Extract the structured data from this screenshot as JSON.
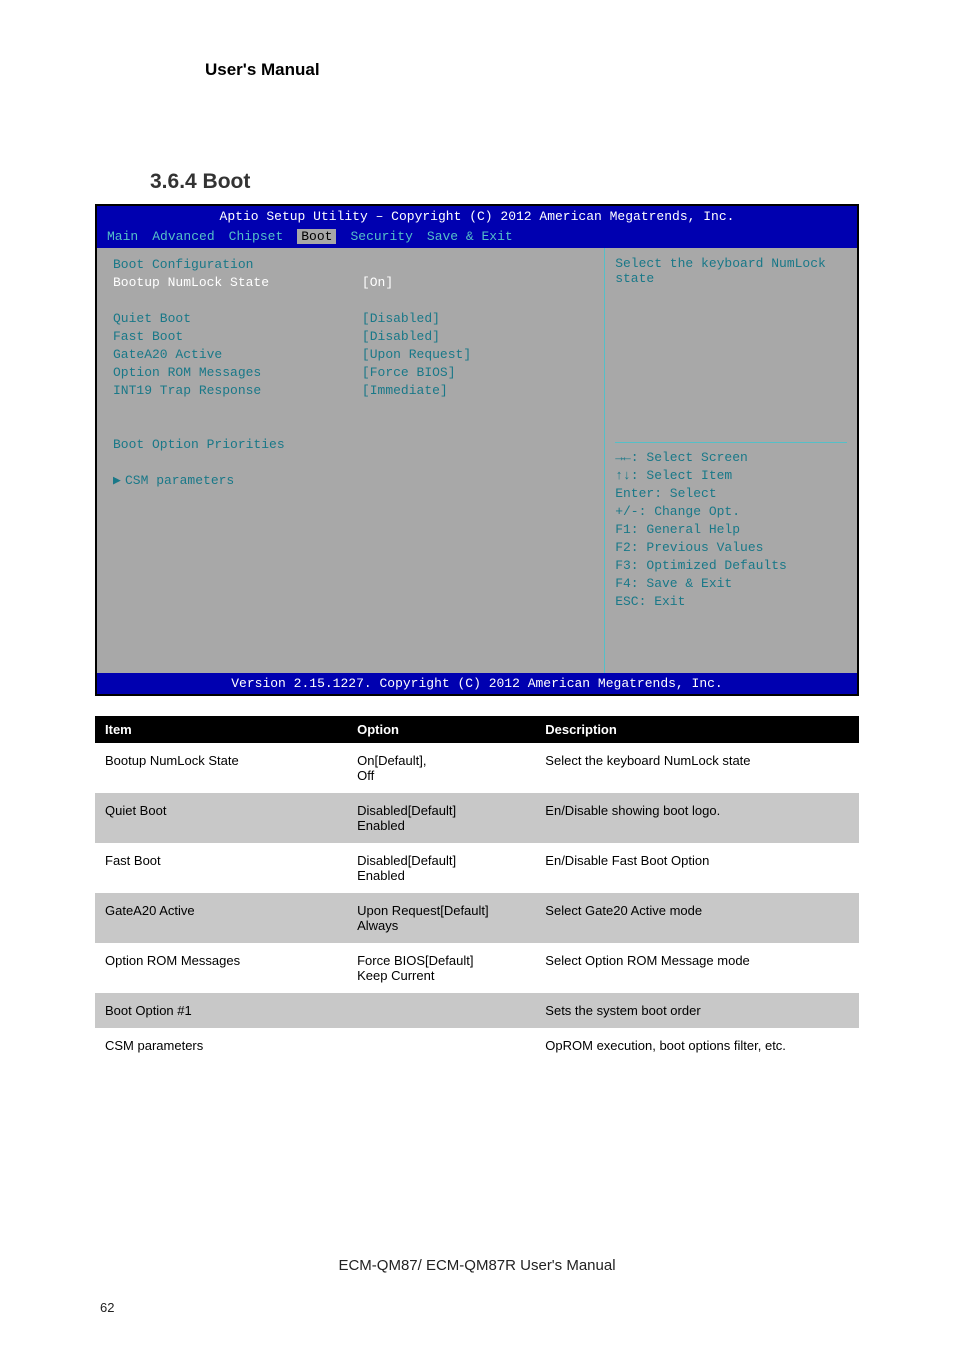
{
  "doc": {
    "header": "User's Manual",
    "section": "3.6.4 Boot",
    "footer_line": "ECM-QM87/ ECM-QM87R User's Manual",
    "page_number": "62"
  },
  "bios": {
    "titlebar": "Aptio Setup Utility – Copyright (C) 2012 American Megatrends, Inc.",
    "tabs": [
      "Main",
      "Advanced",
      "Chipset",
      "Boot",
      "Security",
      "Save & Exit"
    ],
    "selected_tab": "Boot",
    "section_header": "Boot Configuration",
    "rows": [
      {
        "label": "Bootup NumLock State",
        "value": "[On]",
        "highlight": true
      },
      {
        "spacer": true
      },
      {
        "label": "Quiet Boot",
        "value": "[Disabled]"
      },
      {
        "label": "Fast Boot",
        "value": "[Disabled]"
      },
      {
        "label": "GateA20 Active",
        "value": "[Upon Request]"
      },
      {
        "label": "Option ROM Messages",
        "value": "[Force BIOS]"
      },
      {
        "label": "INT19 Trap Response",
        "value": "[Immediate]"
      },
      {
        "spacer": true
      },
      {
        "spacer": true
      },
      {
        "label": "Boot Option Priorities",
        "plain": true
      },
      {
        "spacer": true
      }
    ],
    "submenu": "CSM parameters",
    "help_text": "Select the keyboard NumLock state",
    "keys": [
      "→←: Select Screen",
      "↑↓: Select Item",
      "Enter: Select",
      "+/-: Change Opt.",
      "F1: General Help",
      "F2: Previous Values",
      "F3: Optimized Defaults",
      "F4: Save & Exit",
      "ESC: Exit"
    ],
    "footer": "Version 2.15.1227. Copyright (C) 2012 American Megatrends, Inc."
  },
  "table": {
    "headers": [
      "Item",
      "Option",
      "Description"
    ],
    "rows": [
      {
        "item": "Bootup NumLock State",
        "option": "On[Default],\nOff",
        "desc": "Select the keyboard NumLock state"
      },
      {
        "item": "Quiet Boot",
        "option": "Disabled[Default]\nEnabled",
        "desc": "En/Disable showing boot logo."
      },
      {
        "item": "Fast Boot",
        "option": "Disabled[Default]\nEnabled",
        "desc": "En/Disable Fast Boot Option"
      },
      {
        "item": "GateA20 Active",
        "option": "Upon Request[Default]\nAlways",
        "desc": "Select Gate20 Active mode"
      },
      {
        "item": "Option ROM Messages",
        "option": "Force BIOS[Default]\nKeep Current",
        "desc": "Select Option ROM Message mode"
      },
      {
        "item": "Boot Option #1",
        "option": "",
        "desc": "Sets the system boot order"
      },
      {
        "item": "CSM parameters",
        "option": "",
        "desc": "OpROM execution, boot options filter, etc."
      }
    ]
  }
}
